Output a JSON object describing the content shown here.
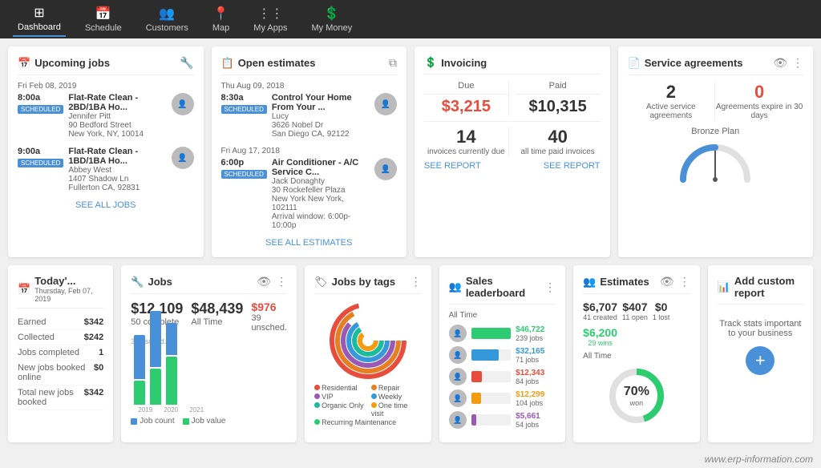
{
  "nav": {
    "items": [
      {
        "label": "Dashboard",
        "icon": "⊞"
      },
      {
        "label": "Schedule",
        "icon": "📅"
      },
      {
        "label": "Customers",
        "icon": "👥"
      },
      {
        "label": "Map",
        "icon": "📍"
      },
      {
        "label": "My Apps",
        "icon": "⋮⋮"
      },
      {
        "label": "My Money",
        "icon": "💲"
      }
    ]
  },
  "upcoming_jobs": {
    "title": "Upcoming jobs",
    "entries": [
      {
        "date": "Fri Feb 08, 2019",
        "time": "8:00a",
        "badge": "SCHEDULED",
        "job": "Flat-Rate Clean - 2BD/1BA Ho...",
        "person": "Jennifer Pitt",
        "address1": "90 Bedford Street",
        "address2": "New York, NY, 10014"
      },
      {
        "date": "",
        "time": "9:00a",
        "badge": "SCHEDULED",
        "job": "Flat-Rate Clean - 1BD/1BA Ho...",
        "person": "Abbey West",
        "address1": "1407 Shadow Ln",
        "address2": "Fullerton CA, 92831"
      }
    ],
    "see_all": "SEE ALL JOBS"
  },
  "open_estimates": {
    "title": "Open estimates",
    "entries": [
      {
        "date": "Thu Aug 09, 2018",
        "time": "8:30a",
        "badge": "SCHEDULED",
        "job": "Control Your Home From Your ...",
        "person": "Lucy",
        "address1": "3626 Nobel Dr",
        "address2": "San Diego CA, 92122"
      },
      {
        "date": "Fri Aug 17, 2018",
        "time": "6:00p",
        "badge": "SCHEDULED",
        "job": "Air Conditioner - A/C Service C...",
        "person": "Jack Donaghty",
        "address1": "30 Rockefeller Plaza",
        "address2": "New York New York, 102111",
        "note": "Arrival window: 6:00p-10:00p"
      }
    ],
    "see_all": "SEE ALL ESTIMATES"
  },
  "invoicing": {
    "title": "Invoicing",
    "due_label": "Due",
    "paid_label": "Paid",
    "due_amount": "$3,215",
    "paid_amount": "$10,315",
    "due_count": "14",
    "due_sub": "invoices currently due",
    "paid_count": "40",
    "paid_sub": "all time paid invoices",
    "see_report": "SEE REPORT"
  },
  "service_agreements": {
    "title": "Service agreements",
    "active_count": "2",
    "active_label": "Active service agreements",
    "expiring_count": "0",
    "expiring_label": "Agreements expire in 30 days",
    "plan_label": "Bronze Plan"
  },
  "today": {
    "title": "Today'...",
    "subtitle": "Thursday, Feb 07, 2019",
    "rows": [
      {
        "label": "Earned",
        "value": "$342"
      },
      {
        "label": "Collected",
        "value": "$242"
      },
      {
        "label": "Jobs completed",
        "value": "1"
      },
      {
        "label": "New jobs booked online",
        "value": "$0"
      },
      {
        "label": "Total new jobs booked",
        "value": "$342"
      }
    ]
  },
  "jobs": {
    "title": "Jobs",
    "big_amount": "$12,109",
    "all_time": "$48,439",
    "unscheduled": "$976",
    "complete_count": "50 complete",
    "all_time_count": "All Time",
    "sched_count": "354 sched.",
    "unsched_count": "39 unsched.",
    "legend": [
      {
        "label": "Job count",
        "color": "#4a90d9"
      },
      {
        "label": "Job value",
        "color": "#2ecc71"
      }
    ],
    "bars": [
      {
        "count_h": 55,
        "value_h": 30
      },
      {
        "count_h": 70,
        "value_h": 45
      },
      {
        "count_h": 40,
        "value_h": 60
      }
    ],
    "x_labels": [
      "2019",
      "2020",
      "2021"
    ]
  },
  "jobs_by_tags": {
    "title": "Jobs by tags",
    "tags": [
      {
        "label": "Residential",
        "color": "#e74c3c"
      },
      {
        "label": "Repair",
        "color": "#e67e22"
      },
      {
        "label": "VIP",
        "color": "#9b59b6"
      },
      {
        "label": "Weekly",
        "color": "#3498db"
      },
      {
        "label": "Organic Only",
        "color": "#1abc9c"
      },
      {
        "label": "One time visit",
        "color": "#f39c12"
      },
      {
        "label": "Recurring Maintenance",
        "color": "#2ecc71"
      }
    ]
  },
  "sales_leaderboard": {
    "title": "Sales leaderboard",
    "subtitle": "All Time",
    "leaders": [
      {
        "name": "",
        "amount": "$46,722",
        "jobs": "239 jobs",
        "bar_pct": 100,
        "color": "#2ecc71"
      },
      {
        "name": "",
        "amount": "$32,165",
        "jobs": "71 jobs",
        "bar_pct": 69,
        "color": "#3498db"
      },
      {
        "name": "",
        "amount": "$12,343",
        "jobs": "84 jobs",
        "bar_pct": 26,
        "color": "#e74c3c"
      },
      {
        "name": "",
        "amount": "$12,299",
        "jobs": "104 jobs",
        "bar_pct": 25,
        "color": "#f39c12"
      },
      {
        "name": "",
        "amount": "$5,661",
        "jobs": "54 jobs",
        "bar_pct": 12,
        "color": "#9b59b6"
      }
    ]
  },
  "estimates": {
    "title": "Estimates",
    "nums": [
      {
        "num": "$6,707",
        "label": "41 created",
        "color": "#333"
      },
      {
        "num": "$407",
        "label": "11 open",
        "color": "#333"
      },
      {
        "num": "$0",
        "label": "1 lost",
        "color": "#333"
      },
      {
        "num": "$6,200",
        "label": "29 wins",
        "color": "#2ecc71"
      }
    ],
    "subtitle": "All Time",
    "win_pct": 70,
    "win_label": "won"
  },
  "add_custom": {
    "title": "Add custom report",
    "description": "Track stats important to your business",
    "btn_label": "+"
  },
  "watermark": "www.erp-information.com"
}
